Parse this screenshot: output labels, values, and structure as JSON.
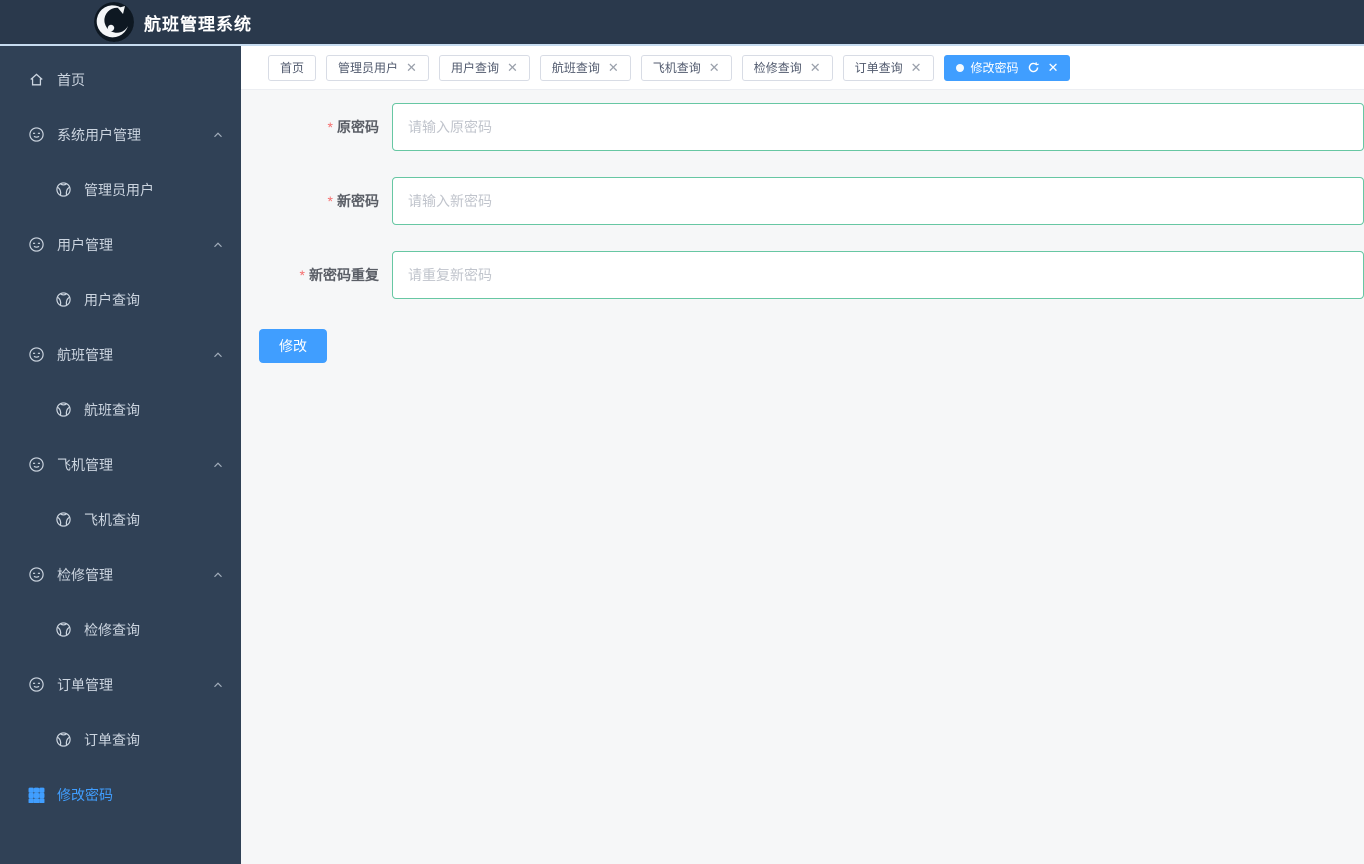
{
  "header": {
    "title": "航班管理系统",
    "logo": "cat-emblem"
  },
  "sidebar": {
    "items": [
      {
        "label": "首页",
        "icon": "home",
        "level": "top"
      },
      {
        "label": "系统用户管理",
        "icon": "eleme-circle",
        "level": "group",
        "expanded": true
      },
      {
        "label": "管理员用户",
        "icon": "football",
        "level": "child"
      },
      {
        "label": "用户管理",
        "icon": "eleme-circle",
        "level": "group",
        "expanded": true
      },
      {
        "label": "用户查询",
        "icon": "football",
        "level": "child"
      },
      {
        "label": "航班管理",
        "icon": "eleme-circle",
        "level": "group",
        "expanded": true
      },
      {
        "label": "航班查询",
        "icon": "football",
        "level": "child"
      },
      {
        "label": "飞机管理",
        "icon": "eleme-circle",
        "level": "group",
        "expanded": true
      },
      {
        "label": "飞机查询",
        "icon": "football",
        "level": "child"
      },
      {
        "label": "检修管理",
        "icon": "eleme-circle",
        "level": "group",
        "expanded": true
      },
      {
        "label": "检修查询",
        "icon": "football",
        "level": "child"
      },
      {
        "label": "订单管理",
        "icon": "eleme-circle",
        "level": "group",
        "expanded": true
      },
      {
        "label": "订单查询",
        "icon": "football",
        "level": "child"
      },
      {
        "label": "修改密码",
        "icon": "grid-menu",
        "level": "top",
        "active": true
      }
    ]
  },
  "tabs": [
    {
      "label": "首页",
      "closable": false,
      "active": false
    },
    {
      "label": "管理员用户",
      "closable": true,
      "active": false
    },
    {
      "label": "用户查询",
      "closable": true,
      "active": false
    },
    {
      "label": "航班查询",
      "closable": true,
      "active": false
    },
    {
      "label": "飞机查询",
      "closable": true,
      "active": false
    },
    {
      "label": "检修查询",
      "closable": true,
      "active": false
    },
    {
      "label": "订单查询",
      "closable": true,
      "active": false
    },
    {
      "label": "修改密码",
      "closable": true,
      "active": true,
      "refreshable": true
    }
  ],
  "form": {
    "fields": [
      {
        "label": "原密码",
        "required": true,
        "value": "",
        "placeholder": "请输入原密码"
      },
      {
        "label": "新密码",
        "required": true,
        "value": "",
        "placeholder": "请输入新密码"
      },
      {
        "label": "新密码重复",
        "required": true,
        "value": "",
        "placeholder": "请重复新密码"
      }
    ],
    "submit_label": "修改"
  },
  "colors": {
    "accent": "#409EFF",
    "header_bg": "#2a394c",
    "sidebar_bg": "#304156",
    "input_border": "#67c7a3",
    "required_mark": "#f56c6c"
  }
}
